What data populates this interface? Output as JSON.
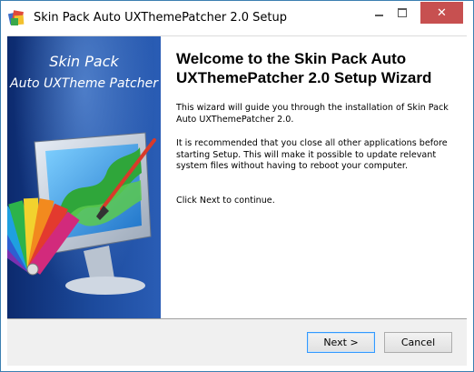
{
  "window": {
    "title": "Skin Pack Auto UXThemePatcher 2.0 Setup",
    "controls": {
      "minimize": "minimize",
      "maximize": "maximize",
      "close": "✕"
    }
  },
  "side_panel": {
    "line1": "Skin Pack",
    "line2": "Auto UXTheme Patcher",
    "colors": {
      "panel_dark": "#0c2a6e",
      "panel_light": "#2a5db5"
    }
  },
  "main": {
    "heading": "Welcome to the  Skin Pack Auto UXThemePatcher 2.0 Setup Wizard",
    "paragraph1": "This wizard will guide you through the installation of  Skin Pack Auto UXThemePatcher 2.0.",
    "paragraph2": "It is recommended that you close all other applications before starting Setup. This will make it possible to update relevant system files without having to reboot your computer.",
    "paragraph3": "Click Next to continue."
  },
  "footer": {
    "next_label": "Next >",
    "cancel_label": "Cancel"
  },
  "colors": {
    "close_button": "#c75050",
    "window_border": "#3c7fb1",
    "default_button_border": "#3399ff"
  },
  "icons": [
    "installer-app-icon",
    "minimize-icon",
    "maximize-icon",
    "close-icon",
    "monitor-palette-artwork"
  ]
}
